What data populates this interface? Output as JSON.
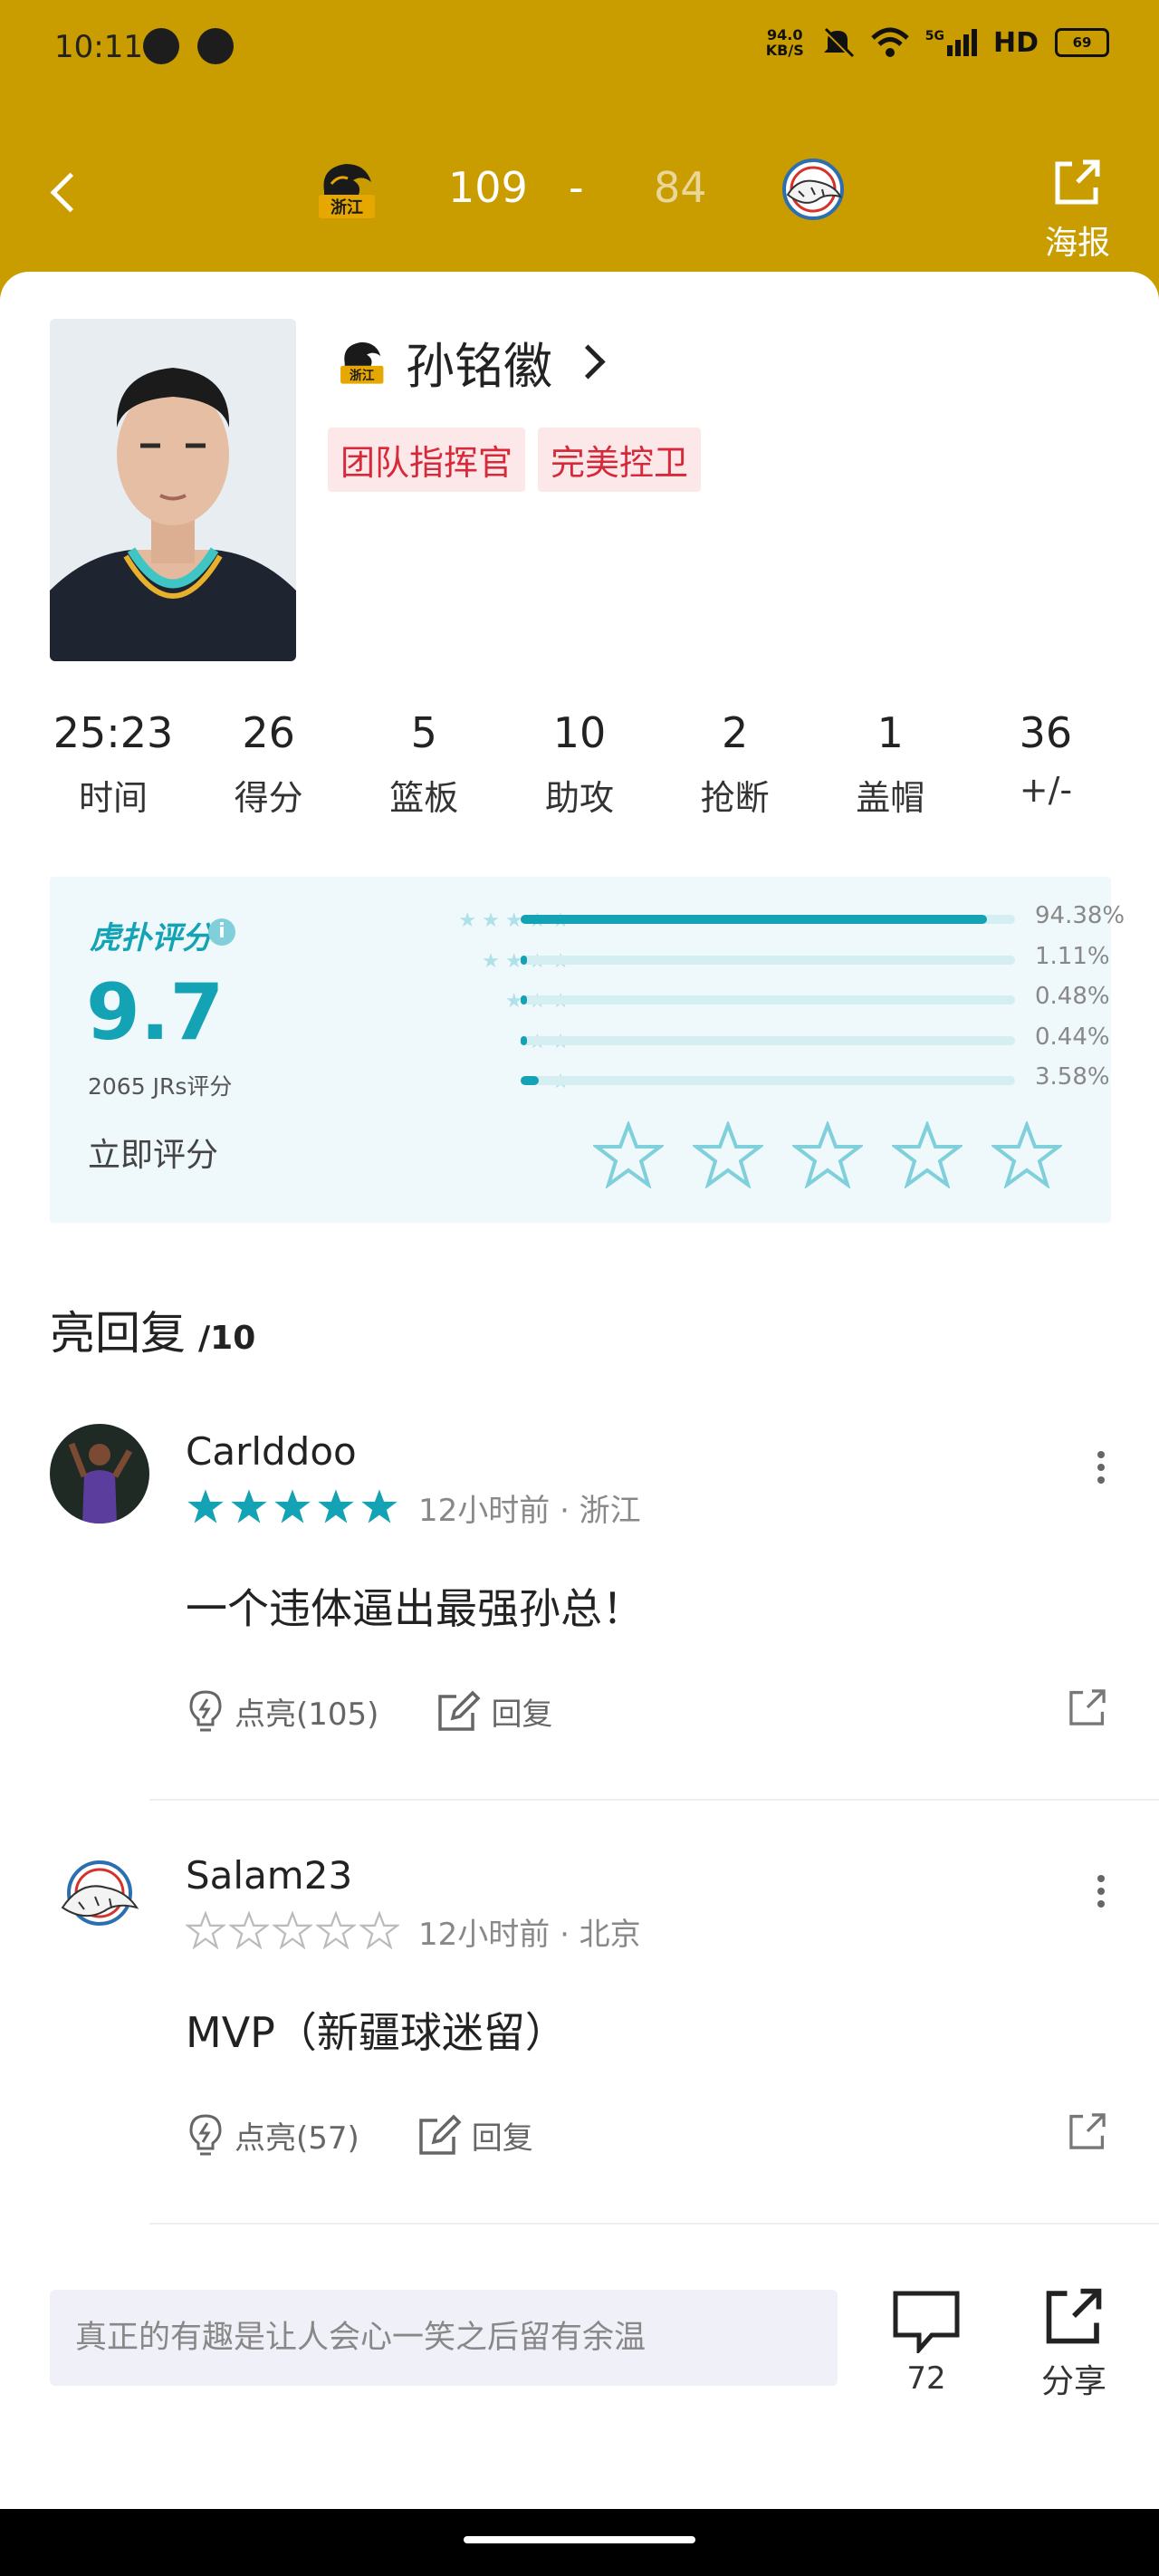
{
  "status_bar": {
    "time": "10:11",
    "net_speed_value": "94.0",
    "net_speed_unit": "KB/S",
    "network": "5G",
    "hd": "HD",
    "battery": "69"
  },
  "header": {
    "home_team_logo_text": "浙江",
    "home_score": "109",
    "separator": "-",
    "away_score": "84",
    "poster_label": "海报"
  },
  "player": {
    "name": "孙铭徽",
    "team_logo_text": "浙江",
    "tags": [
      "团队指挥官",
      "完美控卫"
    ]
  },
  "stats": [
    {
      "value": "25:23",
      "label": "时间"
    },
    {
      "value": "26",
      "label": "得分"
    },
    {
      "value": "5",
      "label": "篮板"
    },
    {
      "value": "10",
      "label": "助攻"
    },
    {
      "value": "2",
      "label": "抢断"
    },
    {
      "value": "1",
      "label": "盖帽"
    },
    {
      "value": "36",
      "label": "+/-"
    }
  ],
  "rating": {
    "brand": "虎扑评分",
    "score": "9.7",
    "count_text": "2065 JRs评分",
    "rate_now": "立即评分",
    "distribution": [
      {
        "stars": 5,
        "percent": 94.38,
        "label": "94.38%"
      },
      {
        "stars": 4,
        "percent": 1.11,
        "label": "1.11%"
      },
      {
        "stars": 3,
        "percent": 0.48,
        "label": "0.48%"
      },
      {
        "stars": 2,
        "percent": 0.44,
        "label": "0.44%"
      },
      {
        "stars": 1,
        "percent": 3.58,
        "label": "3.58%"
      }
    ],
    "accent_color": "#14a3b4"
  },
  "replies_section": {
    "title": "亮回复",
    "count": "/10"
  },
  "replies": [
    {
      "username": "Carlddoo",
      "stars_filled": 5,
      "meta": "12小时前 · 浙江",
      "text": "一个违体逼出最强孙总！",
      "like_label": "点亮(105)",
      "reply_label": "回复"
    },
    {
      "username": "Salam23",
      "stars_filled": 0,
      "meta": "12小时前 · 北京",
      "text": "MVP（新疆球迷留）",
      "like_label": "点亮(57)",
      "reply_label": "回复"
    }
  ],
  "bottom_bar": {
    "comment_placeholder": "真正的有趣是让人会心一笑之后留有余温",
    "comment_count": "72",
    "share_label": "分享"
  },
  "colors": {
    "header_bg": "#c99c00",
    "tag_bg": "#fde8e9",
    "tag_text": "#d62a3a"
  }
}
